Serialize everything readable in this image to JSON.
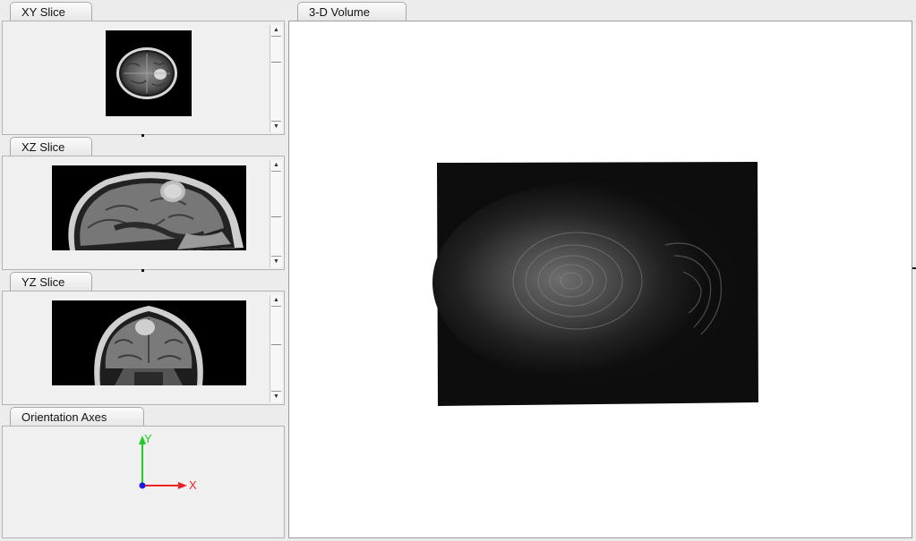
{
  "panels": {
    "xy": {
      "tab_label": "XY Slice"
    },
    "xz": {
      "tab_label": "XZ Slice"
    },
    "yz": {
      "tab_label": "YZ Slice"
    },
    "axes": {
      "tab_label": "Orientation Axes",
      "y_label": "Y",
      "x_label": "X"
    }
  },
  "volume": {
    "tab_label": "3-D Volume"
  },
  "icons": {
    "scroll_up": "triangle-up-icon",
    "scroll_down": "triangle-down-icon"
  },
  "colors": {
    "axis_y": "#22cc22",
    "axis_x": "#ee2222",
    "origin": "#1a1ae6",
    "volume_bg": "#ffffff",
    "slice_bg": "#000000"
  }
}
